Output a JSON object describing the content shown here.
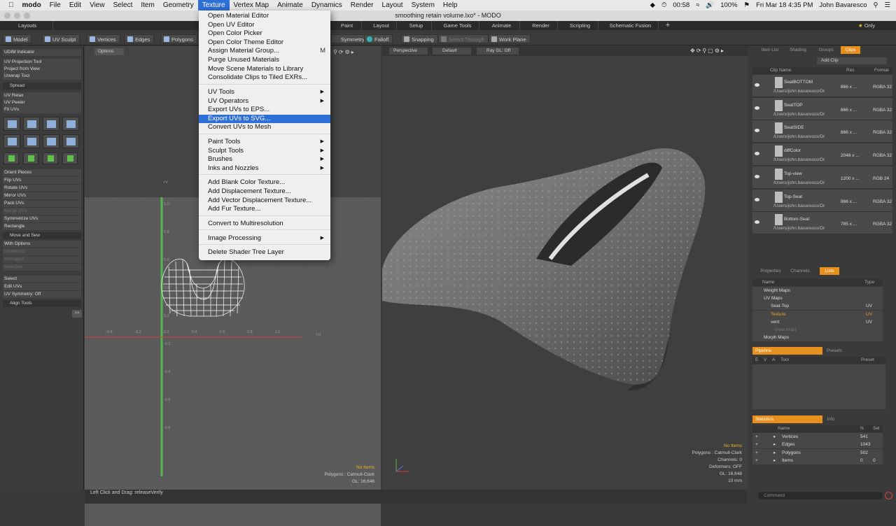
{
  "menubar": {
    "apple_icon": "apple-icon",
    "items": [
      "modo",
      "File",
      "Edit",
      "View",
      "Select",
      "Item",
      "Geometry",
      "Texture",
      "Vertex Map",
      "Animate",
      "Dynamics",
      "Render",
      "Layout",
      "System",
      "Help"
    ],
    "active_index": 7,
    "clock_timer": "00:58",
    "battery": "100%",
    "datetime": "Fri Mar 18  4:35 PM",
    "user": "John Bavaresco"
  },
  "window": {
    "title": "smoothing retain volume.lxo* - MODO"
  },
  "layout_tabs": {
    "layouts_label": "Layouts",
    "tabs": [
      "Paint",
      "Layout",
      "Setup",
      "Game Tools",
      "Animate",
      "Render",
      "Scripting",
      "Schematic Fusion"
    ],
    "add": "+",
    "only_label": "Only"
  },
  "toolbar": {
    "buttons": [
      "Model",
      "UV Sculpt",
      "Vertices",
      "Edges",
      "Polygons",
      "Symmetry",
      "Falloff",
      "Snapping",
      "Select Through",
      "Work Plane"
    ]
  },
  "left_panel": {
    "rows": [
      "UDIM Indicator",
      "UV Projection Tool",
      "Project from View",
      "Unwrap Tool",
      "Spread",
      "UV Relax",
      "UV Peeler",
      "Fit UVs"
    ],
    "rows2": [
      "Orient Pieces",
      "Flip UVs",
      "Rotate UVs",
      "Mirror UVs",
      "Pack UVs",
      "Merge UVs",
      "Symmetrize UVs",
      "Rectangle",
      "Move and Sew",
      "With Options",
      "Unwelded",
      "Averaged",
      "Selected"
    ],
    "rows3": [
      "Select",
      "Edit UVs",
      "UV Symmetry: Off",
      "Align Tools"
    ],
    "expand": ">>"
  },
  "uv_view": {
    "options_label": "Options",
    "axis_v": "+V",
    "axis_u": "+U",
    "ticks_y": [
      "1.0",
      "0.8",
      "0.6",
      "0.4",
      "0.2",
      "-0.2",
      "-0.4",
      "-0.6",
      "-0.8"
    ],
    "ticks_x": [
      "-0.4",
      "-0.2",
      "0.2",
      "0.4",
      "0.6",
      "0.8",
      "1.0"
    ],
    "info": [
      "No Items",
      "Polygons : Catmull-Clark",
      "GL: 16,648"
    ]
  },
  "view3d": {
    "perspective": "Perspective",
    "shading": "Default",
    "raygl": "Ray GL: Off",
    "info": [
      "No Items",
      "Polygons : Catmull-Clark",
      "Channels: 0",
      "Deformers: OFF",
      "GL: 16,648",
      "10 mm"
    ]
  },
  "clips_panel": {
    "tabs": [
      "Item List",
      "Shading",
      "Groups",
      "Clips"
    ],
    "add_clip": "Add Clip",
    "columns": [
      "Clip Name",
      "Res",
      "Format"
    ],
    "clips": [
      {
        "name": "SeatBOTTOM",
        "path": "/Users/john.bavaresco/Dr",
        "res": "866 x ...",
        "format": "RGBA 32"
      },
      {
        "name": "SeatTOP",
        "path": "/Users/john.bavaresco/Dr",
        "res": "866 x ...",
        "format": "RGBA 32"
      },
      {
        "name": "SeatSIDE",
        "path": "/Users/john.bavaresco/Dr",
        "res": "866 x ...",
        "format": "RGBA 32"
      },
      {
        "name": "diffColor",
        "path": "/Users/john.bavaresco/Dr",
        "res": "2048 x ...",
        "format": "RGBA 32"
      },
      {
        "name": "Top-view",
        "path": "/Users/john.bavaresco/Dr",
        "res": "1200 x ...",
        "format": "RGB 24"
      },
      {
        "name": "Top-Seat",
        "path": "/Users/john.bavaresco/Dr",
        "res": "866 x ...",
        "format": "RGBA 32"
      },
      {
        "name": "Bottom-Seat",
        "path": "/Users/john.bavaresco/Dr",
        "res": "785 x ...",
        "format": "RGBA 32"
      }
    ]
  },
  "lists_panel": {
    "tabs": [
      "Properties",
      "Channels",
      "Lists"
    ],
    "columns": [
      "Name",
      "Type"
    ],
    "rows": [
      {
        "name": "Weight Maps",
        "type": ""
      },
      {
        "name": "UV Maps",
        "type": ""
      },
      {
        "name": "Seat-Top",
        "type": "UV"
      },
      {
        "name": "Texture",
        "type": "UV"
      },
      {
        "name": "vent",
        "type": "UV"
      },
      {
        "name": "(new map)",
        "type": ""
      },
      {
        "name": "Morph Maps",
        "type": ""
      }
    ]
  },
  "pipeline_panel": {
    "tabs": [
      "Pipeline",
      "Presets"
    ],
    "columns": [
      "E",
      "V",
      "A",
      "Tool",
      "Preset"
    ]
  },
  "stats_panel": {
    "tabs": [
      "Statistics",
      "Info"
    ],
    "columns": [
      "Name",
      "N",
      "Sel"
    ],
    "rows": [
      {
        "name": "Vertices",
        "n": "541",
        "sel": ""
      },
      {
        "name": "Edges",
        "n": "1043",
        "sel": ""
      },
      {
        "name": "Polygons",
        "n": "502",
        "sel": ""
      },
      {
        "name": "Items",
        "n": "0",
        "sel": "0"
      }
    ]
  },
  "command": {
    "placeholder": "Command"
  },
  "status": {
    "text": "Left Click and Drag:  releaseVerify"
  },
  "texture_menu": {
    "items": [
      {
        "label": "Open Material Editor"
      },
      {
        "label": "Open UV Editor"
      },
      {
        "label": "Open Color Picker"
      },
      {
        "label": "Open Color Theme Editor"
      },
      {
        "label": "Assign Material Group...",
        "shortcut": "M"
      },
      {
        "label": "Purge Unused Materials"
      },
      {
        "label": "Move Scene Materials to Library"
      },
      {
        "label": "Consolidate Clips to Tiled EXRs..."
      },
      {
        "label": "UV Tools",
        "submenu": true
      },
      {
        "label": "UV Operators",
        "submenu": true
      },
      {
        "label": "Export UVs to EPS..."
      },
      {
        "label": "Export UVs to SVG...",
        "selected": true
      },
      {
        "label": "Convert UVs to Mesh"
      },
      {
        "label": "Paint Tools",
        "submenu": true
      },
      {
        "label": "Sculpt Tools",
        "submenu": true
      },
      {
        "label": "Brushes",
        "submenu": true
      },
      {
        "label": "Inks and Nozzles",
        "submenu": true
      },
      {
        "label": "Add Blank Color Texture..."
      },
      {
        "label": "Add Displacement Texture..."
      },
      {
        "label": "Add Vector Displacement Texture..."
      },
      {
        "label": "Add Fur Texture..."
      },
      {
        "label": "Convert to Multiresolution"
      },
      {
        "label": "Image Processing",
        "submenu": true
      },
      {
        "label": "Delete Shader Tree Layer"
      }
    ]
  },
  "colors": {
    "accent": "#e8901e",
    "menu_highlight": "#2f6fd8",
    "uv_wire": "#ffffff",
    "axis_v": "#52b84c",
    "axis_u": "#d83a3a"
  }
}
